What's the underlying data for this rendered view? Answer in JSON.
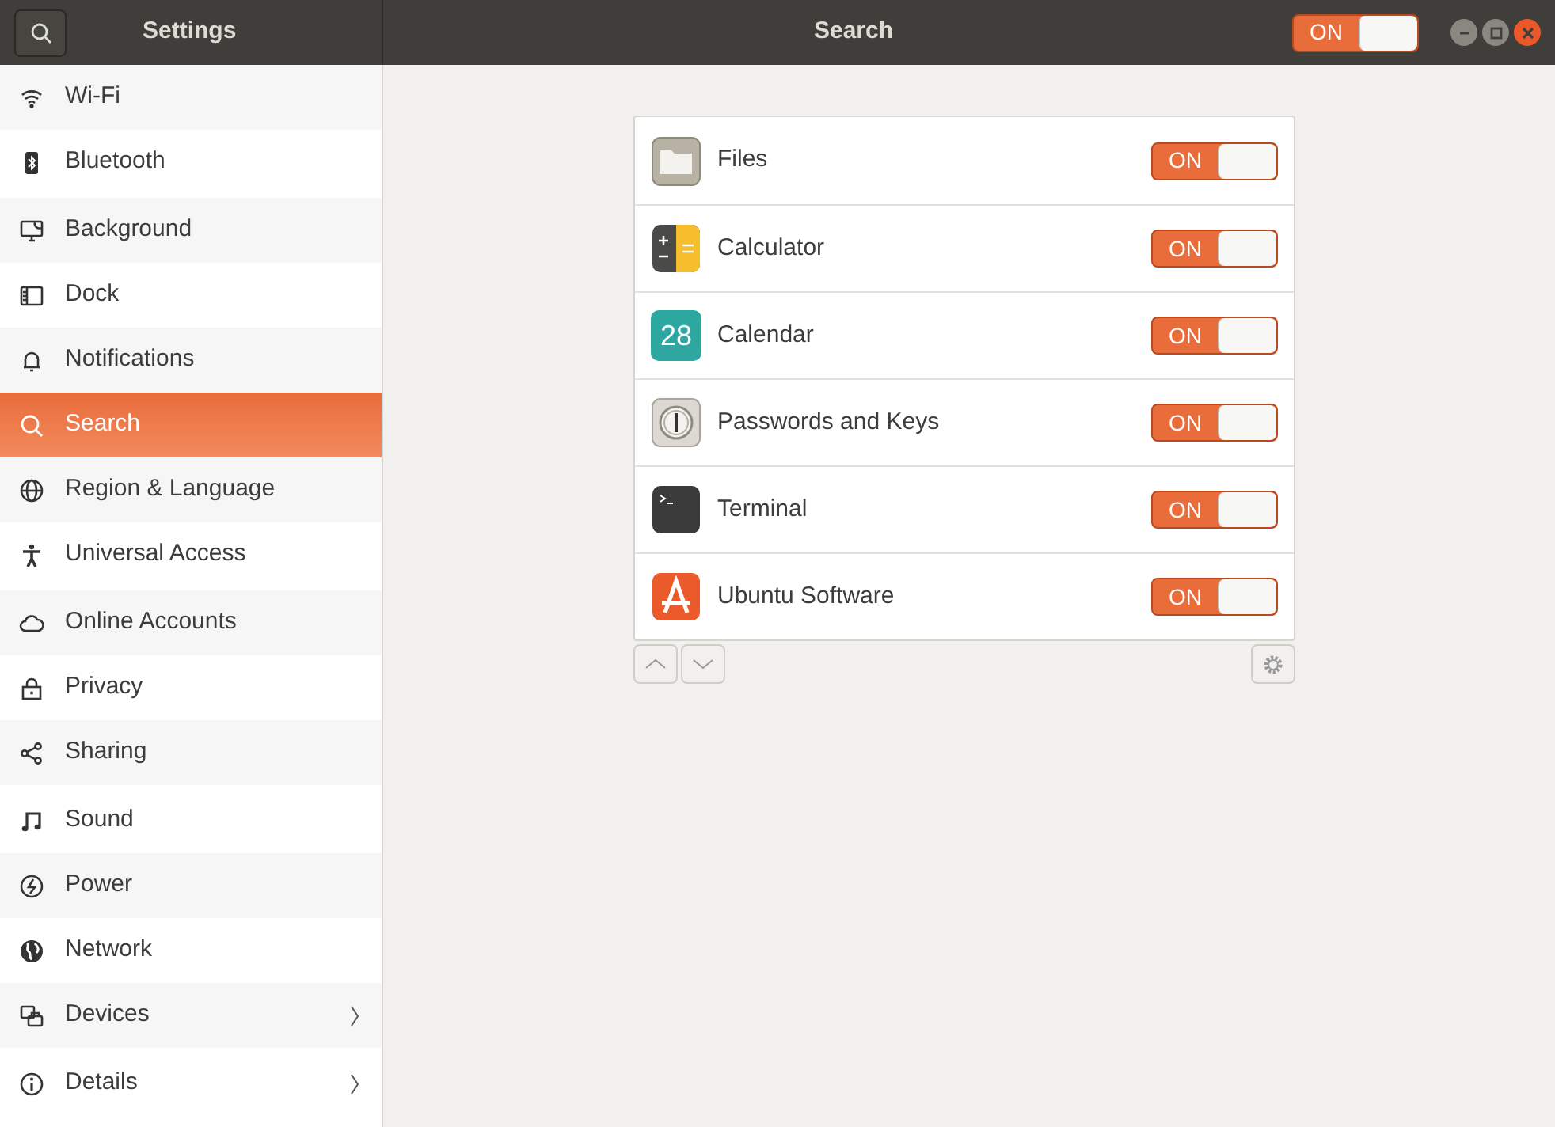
{
  "header": {
    "sidebar_title": "Settings",
    "page_title": "Search",
    "toggle": {
      "label": "ON",
      "on": true
    }
  },
  "sidebar": {
    "groups": [
      {
        "items": [
          {
            "label": "Wi-Fi",
            "selected": false
          },
          {
            "label": "Bluetooth",
            "selected": false
          }
        ]
      },
      {
        "items": [
          {
            "label": "Background",
            "selected": false
          },
          {
            "label": "Dock",
            "selected": false
          },
          {
            "label": "Notifications",
            "selected": false
          },
          {
            "label": "Search",
            "selected": true
          },
          {
            "label": "Region & Language",
            "selected": false
          },
          {
            "label": "Universal Access",
            "selected": false
          }
        ]
      },
      {
        "items": [
          {
            "label": "Online Accounts",
            "selected": false
          },
          {
            "label": "Privacy",
            "selected": false
          },
          {
            "label": "Sharing",
            "selected": false
          }
        ]
      },
      {
        "items": [
          {
            "label": "Sound",
            "selected": false
          },
          {
            "label": "Power",
            "selected": false
          },
          {
            "label": "Network",
            "selected": false
          },
          {
            "label": "Devices",
            "selected": false,
            "has_submenu": true
          }
        ]
      },
      {
        "items": [
          {
            "label": "Details",
            "selected": false,
            "has_submenu": true
          }
        ]
      }
    ]
  },
  "apps": [
    {
      "name": "Files",
      "toggle": {
        "label": "ON",
        "on": true
      }
    },
    {
      "name": "Calculator",
      "toggle": {
        "label": "ON",
        "on": true
      }
    },
    {
      "name": "Calendar",
      "icon_text": "28",
      "toggle": {
        "label": "ON",
        "on": true
      }
    },
    {
      "name": "Passwords and Keys",
      "toggle": {
        "label": "ON",
        "on": true
      }
    },
    {
      "name": "Terminal",
      "toggle": {
        "label": "ON",
        "on": true
      }
    },
    {
      "name": "Ubuntu Software",
      "toggle": {
        "label": "ON",
        "on": true
      }
    }
  ]
}
